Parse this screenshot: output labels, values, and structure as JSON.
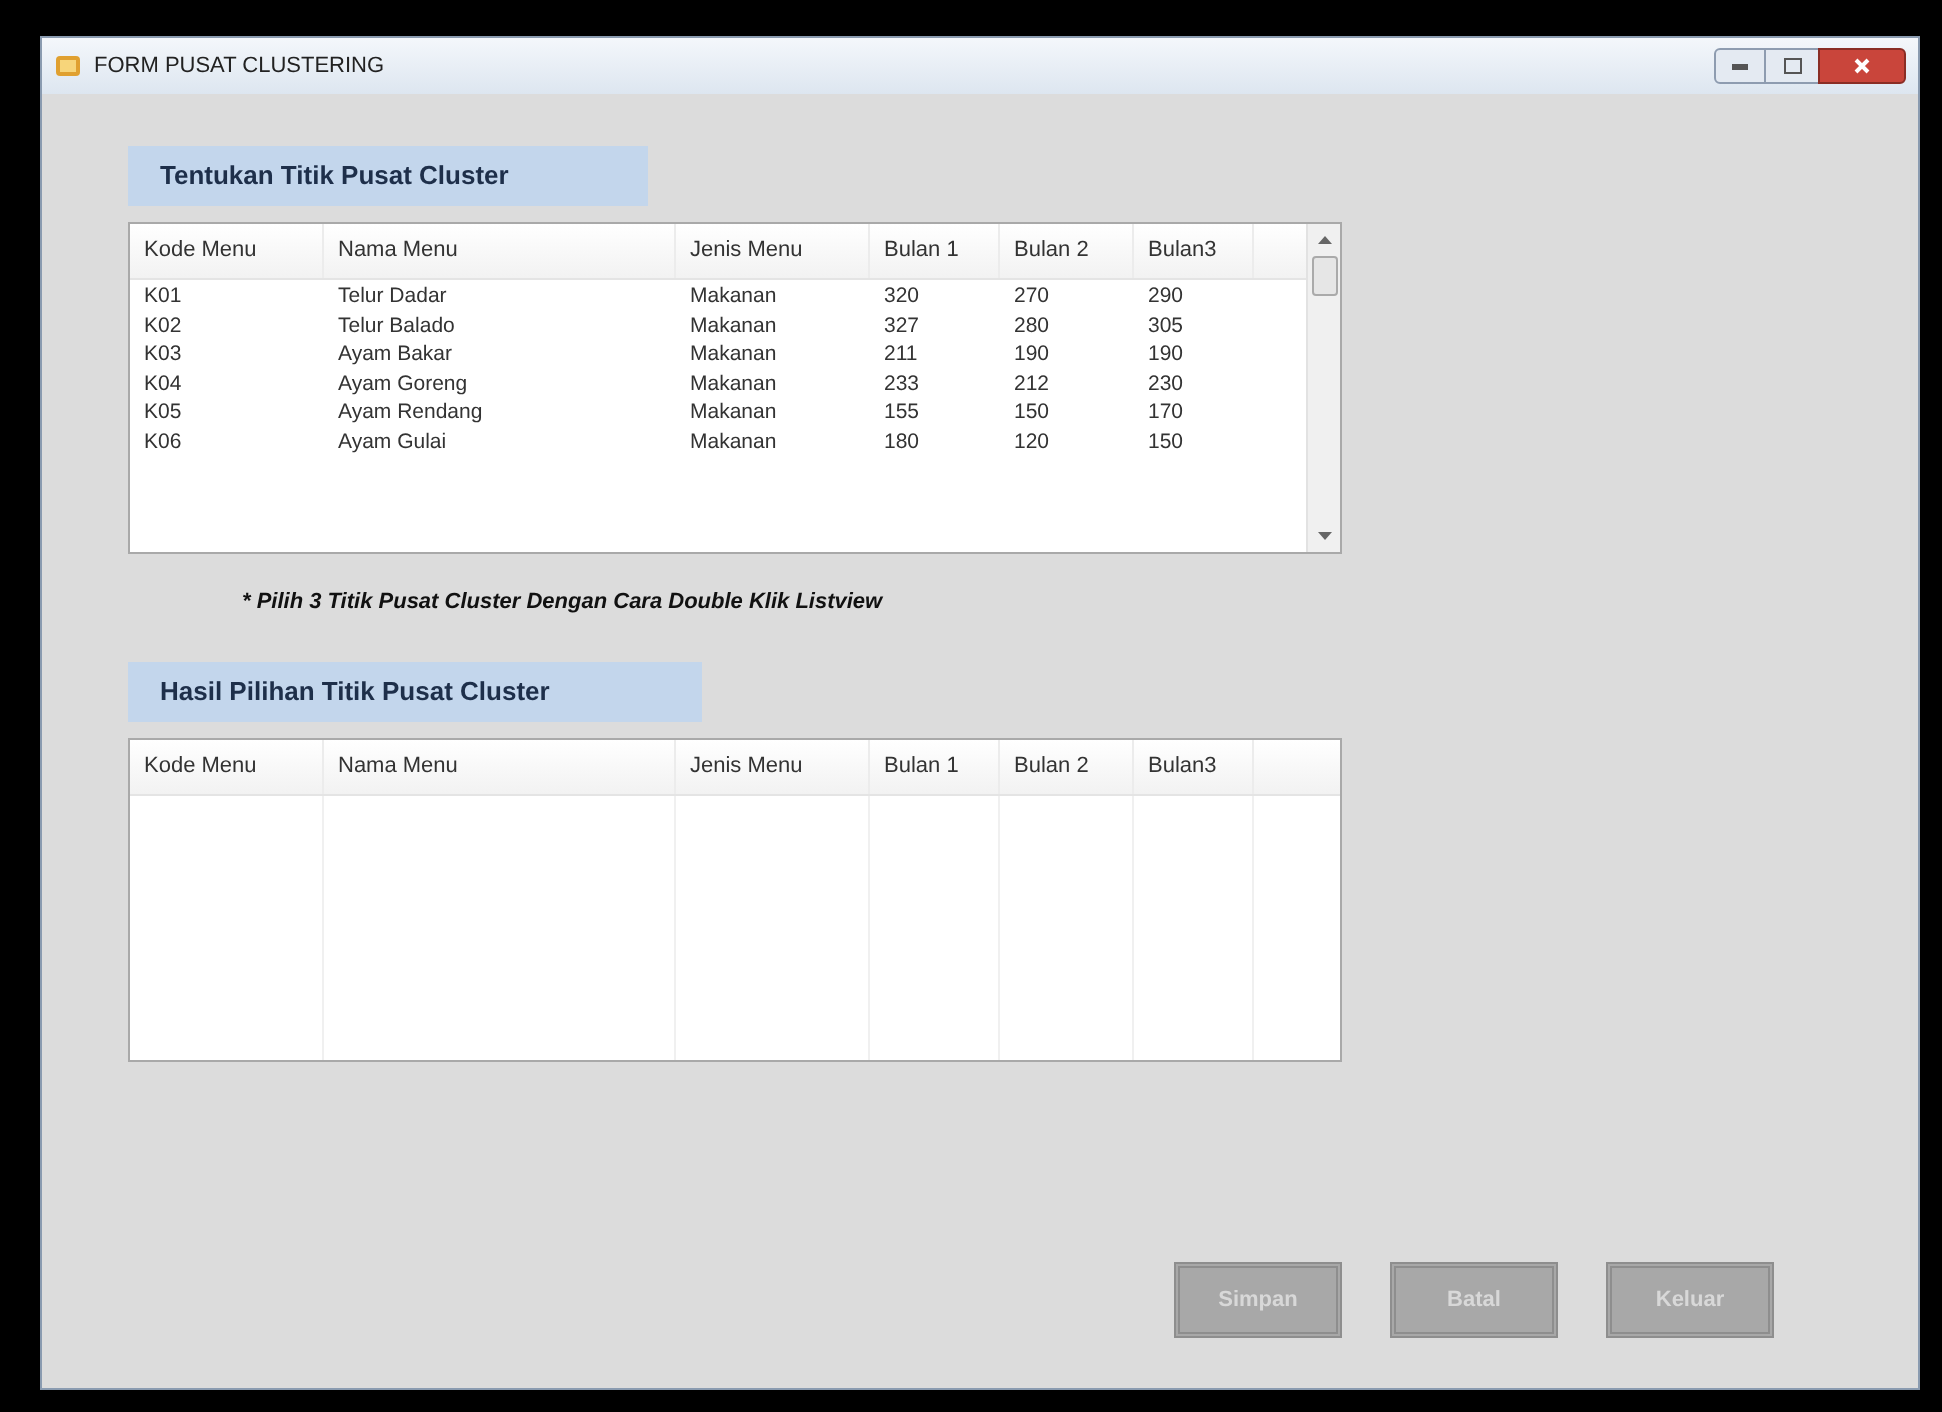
{
  "window": {
    "title": "FORM PUSAT CLUSTERING"
  },
  "section_1": {
    "title": "Tentukan Titik Pusat Cluster"
  },
  "menu_table": {
    "columns": [
      "Kode Menu",
      "Nama Menu",
      "Jenis Menu",
      "Bulan 1",
      "Bulan 2",
      "Bulan3"
    ],
    "rows": [
      [
        "K01",
        "Telur Dadar",
        "Makanan",
        "320",
        "270",
        "290"
      ],
      [
        "K02",
        "Telur Balado",
        "Makanan",
        "327",
        "280",
        "305"
      ],
      [
        "K03",
        "Ayam Bakar",
        "Makanan",
        "211",
        "190",
        "190"
      ],
      [
        "K04",
        "Ayam Goreng",
        "Makanan",
        "233",
        "212",
        "230"
      ],
      [
        "K05",
        "Ayam Rendang",
        "Makanan",
        "155",
        "150",
        "170"
      ],
      [
        "K06",
        "Ayam Gulai",
        "Makanan",
        "180",
        "120",
        "150"
      ]
    ]
  },
  "hint": "* Pilih 3 Titik Pusat Cluster Dengan Cara Double Klik Listview",
  "section_2": {
    "title": "Hasil Pilihan Titik Pusat Cluster"
  },
  "result_table": {
    "columns": [
      "Kode Menu",
      "Nama Menu",
      "Jenis Menu",
      "Bulan 1",
      "Bulan 2",
      "Bulan3"
    ]
  },
  "buttons": [
    {
      "label": "Simpan",
      "disabled": true
    },
    {
      "label": "Batal",
      "disabled": true
    },
    {
      "label": "Keluar",
      "disabled": true
    }
  ]
}
